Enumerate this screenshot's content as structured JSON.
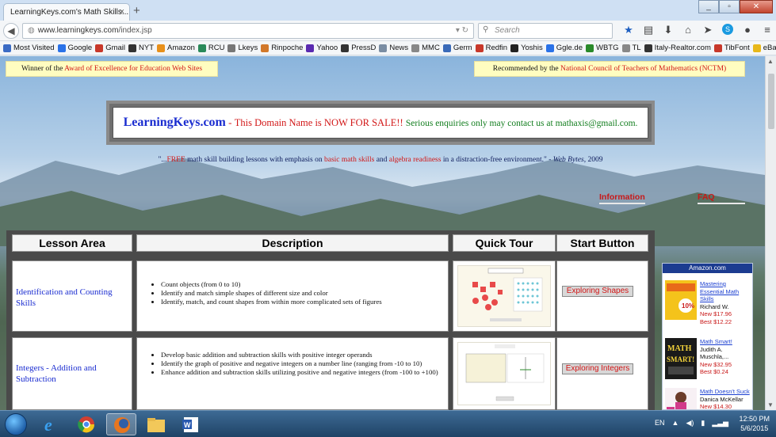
{
  "browser": {
    "tab_title": "LearningKeys.com's Math Skills...",
    "tab_close": "×",
    "new_tab": "+",
    "url_host": "www.learningkeys.com",
    "url_path": "/index.jsp",
    "search_placeholder": "Search"
  },
  "bookmarks": [
    "Most Visited",
    "Google",
    "Gmail",
    "NYT",
    "Amazon",
    "RCU",
    "Lkeys",
    "Rinpoche",
    "Yahoo",
    "PressD",
    "News",
    "MMC",
    "Germ",
    "Redfin",
    "Yoshis",
    "Ggle.de",
    "WBTG",
    "TL",
    "Italy-Realtor.com",
    "TibFont",
    "eBay"
  ],
  "awards": {
    "left_prefix": "Winner of the ",
    "left_highlight": "Award of Excellence for Education Web Sites",
    "right_prefix": "Recommended by the ",
    "right_highlight": "National Council of Teachers of Mathematics (NCTM)"
  },
  "sale": {
    "site": "LearningKeys.com",
    "dash": " - ",
    "red_text": "This Domain Name is NOW FOR SALE!! ",
    "green_text": "Serious enquiries only may contact us at mathaxis@gmail.com."
  },
  "quote": {
    "p1": "\"...",
    "free": "FREE",
    "p2": " math skill building lessons with emphasis on ",
    "basic": "basic math skills",
    "p3": " and ",
    "algebra": "algebra readiness",
    "p4": " in a distraction-free environment.\" - ",
    "source": "Web Bytes",
    "year": ", 2009"
  },
  "links": {
    "information": "Information",
    "faq": "FAQ"
  },
  "table": {
    "headers": {
      "lesson": "Lesson Area",
      "description": "Description",
      "tour": "Quick Tour",
      "start": "Start Button"
    },
    "rows": [
      {
        "lesson": "Identification and Counting Skills",
        "bullets": [
          "Count objects (from 0 to 10)",
          "Identify and match simple shapes of different size and color",
          "Identify, match, and count shapes from within more complicated sets of figures"
        ],
        "button": "Exploring Shapes"
      },
      {
        "lesson": "Integers - Addition and Subtraction",
        "bullets": [
          "Develop basic addition and subtraction skills with positive integer operands",
          "Identify the graph of positive and negative integers on a number line (ranging from -10 to 10)",
          "Enhance addition and subtraction skills utilizing positive and negative integers (from -100 to +100)"
        ],
        "button": "Exploring Integers"
      }
    ]
  },
  "amazon": {
    "header": "Amazon.com",
    "items": [
      {
        "title": "Mastering Essential Math Skills",
        "author": "Richard W.",
        "price_new": "New $17.96",
        "price_best": "Best $12.22"
      },
      {
        "title": "Math Smart!",
        "author": "Judith A. Muschla,...",
        "price_new": "New $32.95",
        "price_best": "Best $0.24"
      },
      {
        "title": "Math Doesn't Suck",
        "author": "Danica McKellar",
        "price_new": "New $14.30",
        "price_best": ""
      }
    ]
  },
  "taskbar": {
    "lang": "EN",
    "time": "12:50 PM",
    "date": "5/6/2015"
  }
}
